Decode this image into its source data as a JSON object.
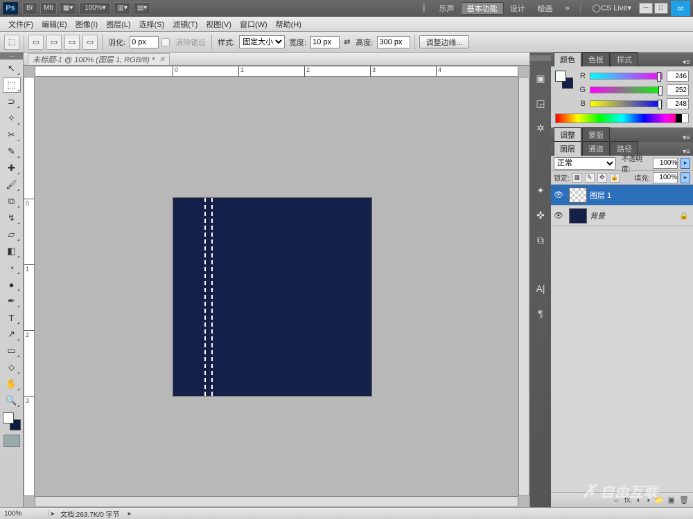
{
  "title": {
    "ps": "Ps",
    "br": "Br",
    "mb": "Mb",
    "zoom": "100%"
  },
  "workspaces": {
    "w1": "乐声",
    "w2": "基本功能",
    "w3": "设计",
    "w4": "绘画",
    "more": "»",
    "cs": "CS Live"
  },
  "menu": {
    "file": "文件(F)",
    "edit": "编辑(E)",
    "image": "图像(I)",
    "layer": "图层(L)",
    "select": "选择(S)",
    "filter": "滤镜(T)",
    "view": "视图(V)",
    "window": "窗口(W)",
    "help": "帮助(H)"
  },
  "opt": {
    "feather_l": "羽化:",
    "feather_v": "0 px",
    "alias": "消除锯齿",
    "style_l": "样式:",
    "style_v": "固定大小",
    "width_l": "宽度:",
    "width_v": "10 px",
    "swap": "⇄",
    "height_l": "高度:",
    "height_v": "300 px",
    "refine": "调整边缘..."
  },
  "doc": {
    "tab": "未标题-1 @ 100% (图层 1, RGB/8) *"
  },
  "ruler": {
    "h": [
      "0",
      "1",
      "2",
      "3",
      "4"
    ],
    "v": [
      "0",
      "1",
      "2",
      "3"
    ]
  },
  "color": {
    "tab1": "颜色",
    "tab2": "色板",
    "tab3": "样式",
    "r_l": "R",
    "r_v": "246",
    "g_l": "G",
    "g_v": "252",
    "b_l": "B",
    "b_v": "248"
  },
  "adjust": {
    "t1": "调整",
    "t2": "蒙版"
  },
  "layers": {
    "t1": "图层",
    "t2": "通道",
    "t3": "路径",
    "blend": "正常",
    "opacity_l": "不透明度:",
    "opacity_v": "100%",
    "lock_l": "锁定:",
    "fill_l": "填充:",
    "fill_v": "100%",
    "l1": "图层 1",
    "l2": "背景"
  },
  "status": {
    "zoom": "100%",
    "doc": "文档:263.7K/0 字节"
  },
  "watermark": "自由互联"
}
